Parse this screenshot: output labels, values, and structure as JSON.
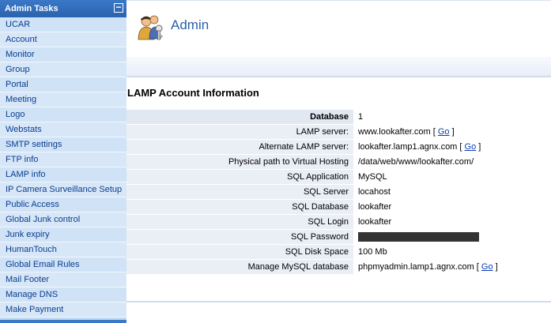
{
  "sidebar": {
    "title": "Admin Tasks",
    "collapse_glyph": "−",
    "items": [
      {
        "label": "UCAR"
      },
      {
        "label": "Account"
      },
      {
        "label": "Monitor"
      },
      {
        "label": "Group"
      },
      {
        "label": "Portal"
      },
      {
        "label": "Meeting"
      },
      {
        "label": "Logo"
      },
      {
        "label": "Webstats"
      },
      {
        "label": "SMTP settings"
      },
      {
        "label": "FTP info"
      },
      {
        "label": "LAMP info"
      },
      {
        "label": "IP Camera Surveillance Setup"
      },
      {
        "label": "Public Access"
      },
      {
        "label": "Global Junk control"
      },
      {
        "label": "Junk expiry"
      },
      {
        "label": "HumanTouch"
      },
      {
        "label": "Global Email Rules"
      },
      {
        "label": "Mail Footer"
      },
      {
        "label": "Manage DNS"
      },
      {
        "label": "Make Payment"
      }
    ]
  },
  "header": {
    "title": "Admin",
    "icon": "admin-users-key-icon"
  },
  "section": {
    "title": "LAMP Account Information"
  },
  "rows": [
    {
      "label": "Database",
      "value": "1",
      "go": ""
    },
    {
      "label": "LAMP server:",
      "value": "www.lookafter.com [ ",
      "go": "Go",
      "suffix": " ]"
    },
    {
      "label": "Alternate LAMP server:",
      "value": "lookafter.lamp1.agnx.com [ ",
      "go": "Go",
      "suffix": " ]"
    },
    {
      "label": "Physical path to Virtual Hosting",
      "value": "/data/web/www/lookafter.com/",
      "go": ""
    },
    {
      "label": "SQL Application",
      "value": "MySQL",
      "go": ""
    },
    {
      "label": "SQL Server",
      "value": "locahost",
      "go": ""
    },
    {
      "label": "SQL Database",
      "value": "lookafter",
      "go": ""
    },
    {
      "label": "SQL Login",
      "value": "lookafter",
      "go": ""
    },
    {
      "label": "SQL Password",
      "value": "",
      "go": "",
      "masked": true
    },
    {
      "label": "SQL Disk Space",
      "value": "100 Mb",
      "go": ""
    },
    {
      "label": "Manage MySQL database",
      "value": "phpmyadmin.lamp1.agnx.com [ ",
      "go": "Go",
      "suffix": " ]"
    }
  ],
  "colors": {
    "link": "#0b3bb5",
    "sidebar_text": "#0a3d8f",
    "header_blue": "#2a5fa8"
  }
}
